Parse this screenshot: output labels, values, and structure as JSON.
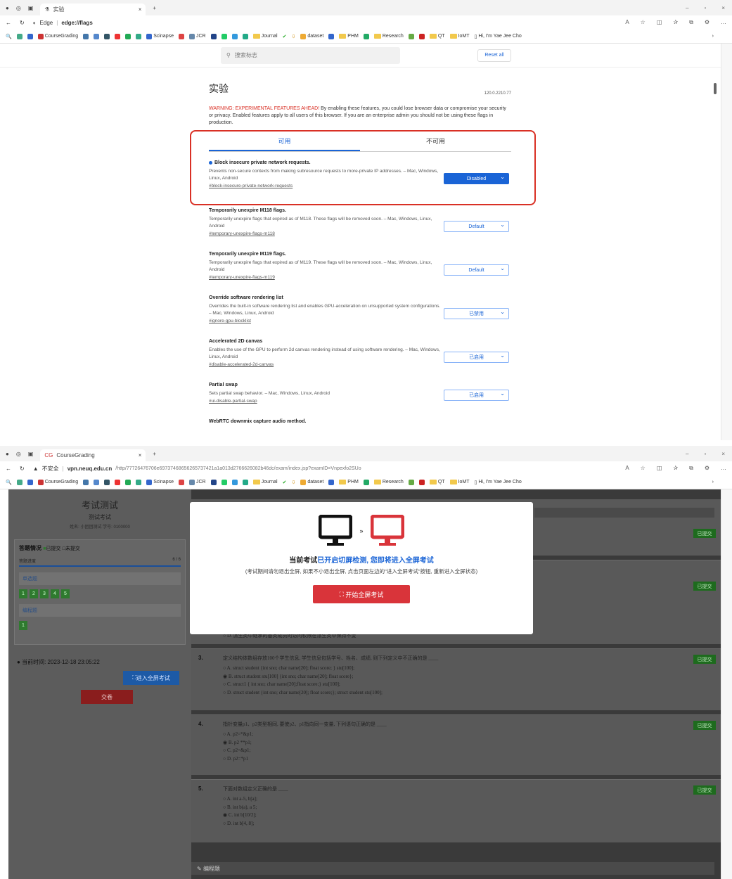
{
  "window1": {
    "tab_title": "实验",
    "url_host": "Edge",
    "url_path": "edge://flags",
    "favorites": [
      "CourseGrading",
      "Scinapse",
      "JCR",
      "Journal",
      "dataset",
      "PHM",
      "Research",
      "QT",
      "IoMT",
      "Hi, I'm Yae Jee Cho"
    ],
    "search_placeholder": "搜索标志",
    "reset_label": "Reset all",
    "page_title": "实验",
    "version": "120.0.2210.77",
    "warning_red": "WARNING: EXPERIMENTAL FEATURES AHEAD!",
    "warning_text": " By enabling these features, you could lose browser data or compromise your security or privacy. Enabled features apply to all users of this browser. If you are an enterprise admin you should not be using these flags in production.",
    "tab_available": "可用",
    "tab_unavailable": "不可用",
    "flags": [
      {
        "title": "Block insecure private network requests.",
        "desc": "Prevents non-secure contexts from making subresource requests to more-private IP addresses. – Mac, Windows, Linux, Android",
        "link": "#block-insecure-private-network-requests",
        "value": "Disabled"
      },
      {
        "title": "Temporarily unexpire M118 flags.",
        "desc": "Temporarily unexpire flags that expired as of M118. These flags will be removed soon. – Mac, Windows, Linux, Android",
        "link": "#temporary-unexpire-flags-m118",
        "value": "Default"
      },
      {
        "title": "Temporarily unexpire M119 flags.",
        "desc": "Temporarily unexpire flags that expired as of M119. These flags will be removed soon. – Mac, Windows, Linux, Android",
        "link": "#temporary-unexpire-flags-m119",
        "value": "Default"
      },
      {
        "title": "Override software rendering list",
        "desc": "Overrides the built-in software rendering list and enables GPU-acceleration on unsupported system configurations. – Mac, Windows, Linux, Android",
        "link": "#ignore-gpu-blocklist",
        "value": "已禁用"
      },
      {
        "title": "Accelerated 2D canvas",
        "desc": "Enables the use of the GPU to perform 2d canvas rendering instead of using software rendering. – Mac, Windows, Linux, Android",
        "link": "#disable-accelerated-2d-canvas",
        "value": "已启用"
      },
      {
        "title": "Partial swap",
        "desc": "Sets partial swap behavior. – Mac, Windows, Linux, Android",
        "link": "#ui-disable-partial-swap",
        "value": "已启用"
      },
      {
        "title": "WebRTC downmix capture audio method.",
        "desc": "",
        "link": "",
        "value": ""
      }
    ]
  },
  "window2": {
    "tab_title": "CourseGrading",
    "security": "不安全",
    "url_host": "vpn.neuq.edu.cn",
    "url_path": "/http/77726476706e69737468656265737421a1a013d2766626082b46dc/exam/index.jsp?examID=Vnpexfo2SUo",
    "exam_title": "考试测试",
    "exam_subtitle": "测试考试",
    "student_info": "姓名: 小团团测试    学号: 0100000",
    "answer_heading": "答题情况",
    "legend_submitted": "已提交",
    "legend_unsubmitted": "未提交",
    "progress_label": "答题进度",
    "progress_value": "6 / 6",
    "progress_fraction": 1.0,
    "section1": "单选题",
    "section1_nums": [
      "1",
      "2",
      "3",
      "4",
      "5"
    ],
    "section2": "编程题",
    "section2_nums": [
      "1"
    ],
    "time_label": "当前时间:",
    "time_value": "2023-12-18 23:05:22",
    "fullscreen_btn": "进入全屏考试",
    "submit_btn": "交卷",
    "submitted_badge": "已提交",
    "modal_line1a": "当前考试",
    "modal_line1b": "已开启切屏检测,",
    "modal_line1c": "您即将进入全屏考试",
    "modal_line2": "(考试期间请勿退出全屏, 如果不小退出全屏, 点击页面左边的\"进入全屏考试\"按钮, 重新进入全屏状态)",
    "modal_start": "开始全屏考试",
    "q2_partial": "D. 派生类中继承的基类成员的访问权限在派生类中保持不变",
    "questions": [
      {
        "num": "3.",
        "text": "定义结构体数组存放100个学生信息, 学生信息包括学号、姓名、成绩, 则下列定义中不正确的是 ____",
        "options": [
          "A. struct student {int sno; char name[20]; float score; } stu[100];",
          "B. struct student stu[100] {int sno; char name[20]; float score};",
          "C. struct1 { int sno; char name[20];float score;} stu[100];",
          "D. struct student {int sno; char name[20]; float score;}; struct student stu[100];"
        ]
      },
      {
        "num": "4.",
        "text": "指针变量p1、p2类型相同, 要使p2、p1指向同一变量, 下列语句正确的是 ____",
        "options": [
          "A. p2=*&p1;",
          "B. p2 **p1;",
          "C. p2=&p1;",
          "D. p2=*p1"
        ]
      },
      {
        "num": "5.",
        "text": "下面对数组定义正确的是 ____",
        "options": [
          "A. int a-5, b[a];",
          "B. int b(a), a 5;",
          "C. int b[10/2];",
          "D. int b[4, 8];"
        ]
      }
    ],
    "programming_heading": "编程题"
  }
}
